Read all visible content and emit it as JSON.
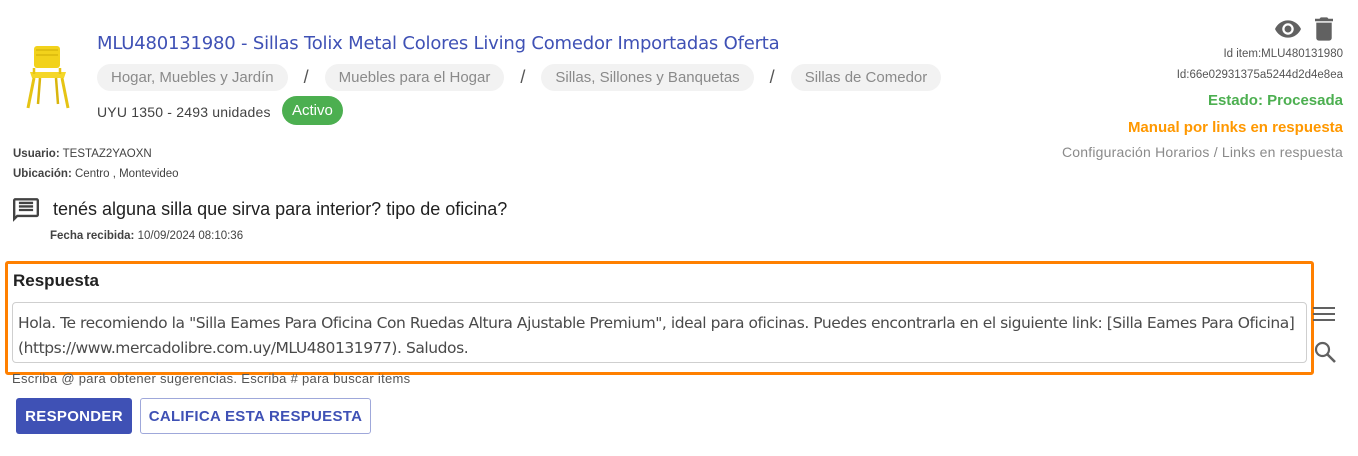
{
  "item": {
    "title": "MLU480131980 - Sillas Tolix Metal Colores Living Comedor Importadas Oferta",
    "breadcrumbs": [
      "Hogar, Muebles y Jardín",
      "Muebles para el Hogar",
      "Sillas, Sillones y Banquetas",
      "Sillas de Comedor"
    ],
    "breadcrumb_separator": "/",
    "price_line": "UYU 1350 - 2493 unidades",
    "status_badge": "Activo",
    "image_icon": "yellow-chair-image"
  },
  "meta": {
    "id_item": "Id item:MLU480131980",
    "id_internal": "Id:66e02931375a5244d2d4e8ea",
    "estado": "Estado: Procesada",
    "manual": "Manual por links en respuesta",
    "config_horarios": "Configuración Horarios",
    "config_sep": "/",
    "links_respuesta": "Links en respuesta"
  },
  "user": {
    "usuario_label": "Usuario:",
    "usuario_value": "TESTAZ2YAOXN",
    "ubicacion_label": "Ubicación:",
    "ubicacion_value": "Centro , Montevideo"
  },
  "question": {
    "text": "tenés alguna silla que sirva para interior? tipo de oficina?",
    "fecha_label": "Fecha recibida:",
    "fecha_value": "10/09/2024 08:10:36"
  },
  "response": {
    "label": "Respuesta",
    "text": "Hola. Te recomiendo la \"Silla Eames Para Oficina Con Ruedas Altura Ajustable Premium\", ideal para oficinas. Puedes encontrarla en el siguiente link: [Silla Eames Para Oficina](https://www.mercadolibre.com.uy/MLU480131977). Saludos.",
    "hint": "Escriba @ para obtener sugerencias. Escriba # para buscar items"
  },
  "actions": {
    "responder": "RESPONDER",
    "califica": "CALIFICA ESTA RESPUESTA"
  },
  "icons": {
    "view": "eye-icon",
    "delete": "trash-icon",
    "question": "comment-icon",
    "list": "list-icon",
    "search": "search-icon"
  },
  "colors": {
    "primary": "#3f51b5",
    "success": "#4caf50",
    "warning": "#ff9800",
    "highlight": "#ff8000"
  }
}
